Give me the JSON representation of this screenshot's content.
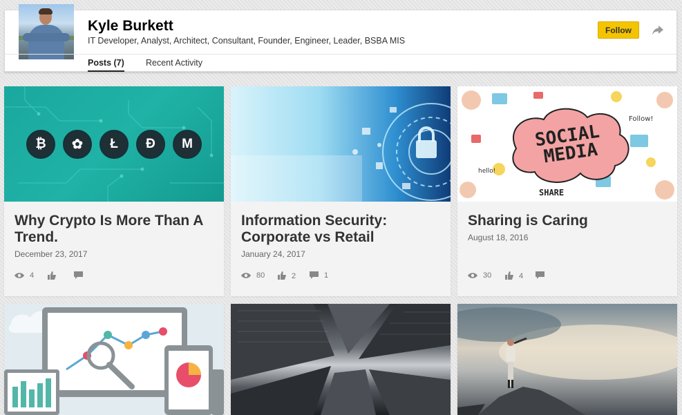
{
  "profile": {
    "name": "Kyle Burkett",
    "headline": "IT Developer, Analyst, Architect, Consultant, Founder, Engineer, Leader, BSBA MIS",
    "follow_label": "Follow"
  },
  "tabs": [
    {
      "label": "Posts (7)",
      "active": true
    },
    {
      "label": "Recent Activity",
      "active": false
    }
  ],
  "posts": [
    {
      "title": "Why Crypto Is More Than A Trend.",
      "date": "December 23, 2017",
      "views": "4",
      "likes": "",
      "comments": "",
      "image": "cryptocurrency-coins",
      "coins": [
        "₿",
        "✿",
        "Ł",
        "Đ",
        "M"
      ]
    },
    {
      "title": "Information Security: Corporate vs Retail",
      "date": "January 24, 2017",
      "views": "80",
      "likes": "2",
      "comments": "1",
      "image": "digital-security-lock"
    },
    {
      "title": "Sharing is Caring",
      "date": "August 18, 2016",
      "views": "30",
      "likes": "4",
      "comments": "",
      "image": "social-media-sketch",
      "image_text": [
        "SOCIAL",
        "MEDIA",
        "SHARE",
        "Follow!",
        "hello!"
      ]
    },
    {
      "image": "analytics-dashboard"
    },
    {
      "image": "skyscrapers-looking-up"
    },
    {
      "image": "woman-on-rock-with-telescope"
    }
  ],
  "icons": {
    "views": "eye-icon",
    "likes": "thumbs-up-icon",
    "comments": "comment-icon",
    "share": "share-arrow-icon"
  },
  "colors": {
    "follow_button": "#f5c400",
    "crypto_teal": "#1aa89e",
    "text_dark": "#333333"
  }
}
